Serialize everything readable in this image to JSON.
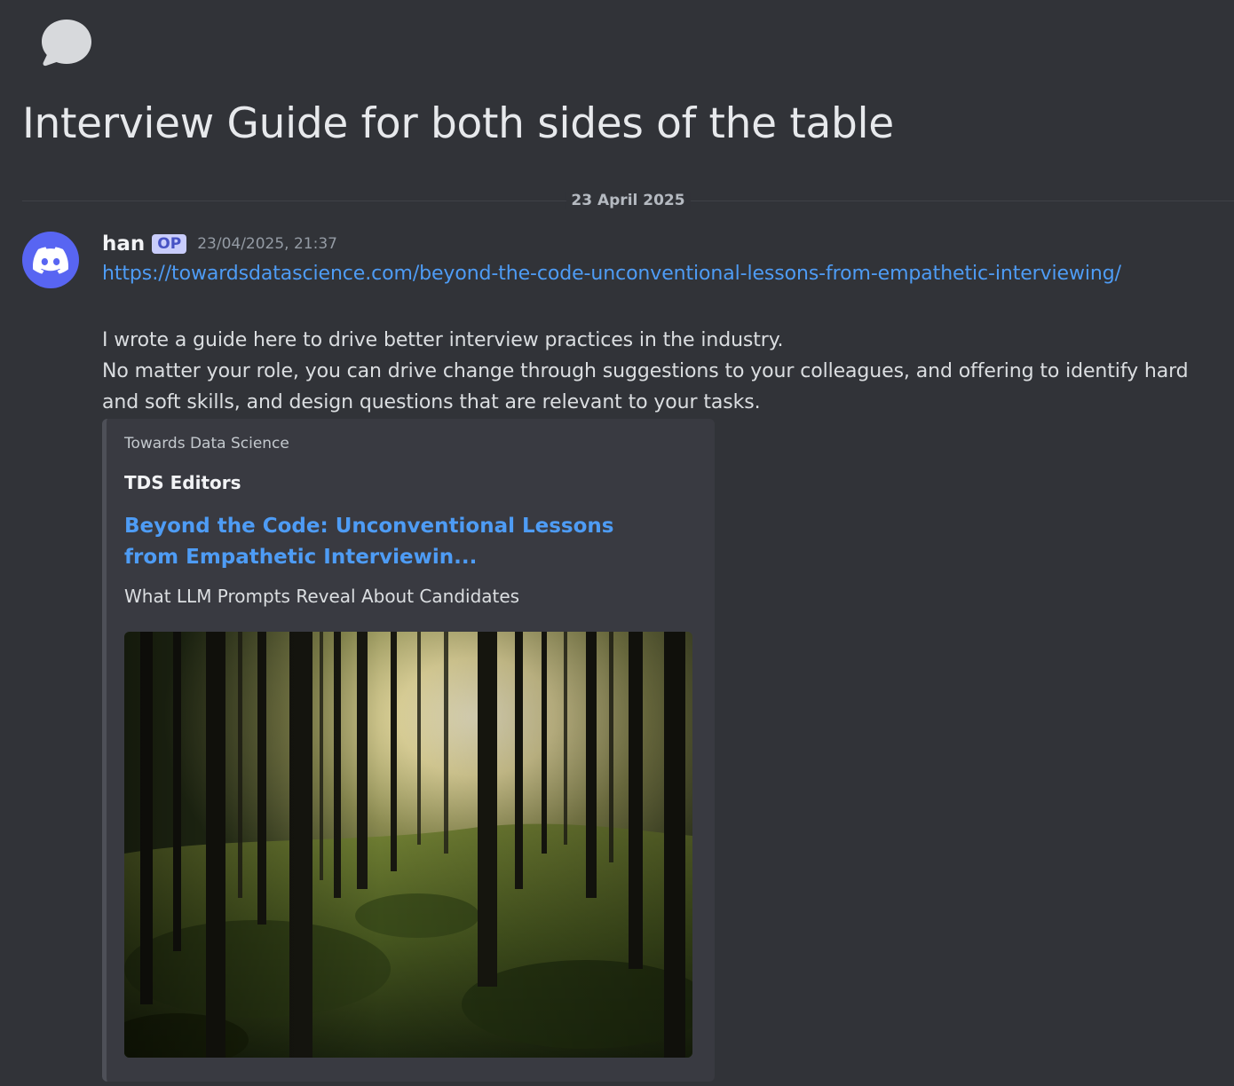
{
  "thread": {
    "icon": "speech-bubble-icon",
    "title": "Interview Guide for both sides of the table"
  },
  "divider": {
    "date": "23 April 2025"
  },
  "message": {
    "avatar_icon": "discord-logo-icon",
    "username": "han",
    "badge": "OP",
    "timestamp": "23/04/2025, 21:37",
    "link": "https://towardsdatascience.com/beyond-the-code-unconventional-lessons-from-empathetic-interviewing/",
    "body_line1": "I wrote a guide here to drive better interview practices in the industry.",
    "body_line2": "No matter your role, you can drive change through suggestions to your colleagues, and offering to identify hard and soft skills, and design questions that are relevant to your tasks."
  },
  "embed": {
    "provider": "Towards Data Science",
    "author": "TDS Editors",
    "title": "Beyond the Code: Unconventional Lessons from Empathetic Interviewin...",
    "description": "What LLM Prompts Reveal About Candidates",
    "image_icon": "forest-photo"
  },
  "colors": {
    "background": "#313338",
    "link": "#4e9cf5",
    "brand": "#5865f2",
    "embed_bg": "#393a41"
  }
}
